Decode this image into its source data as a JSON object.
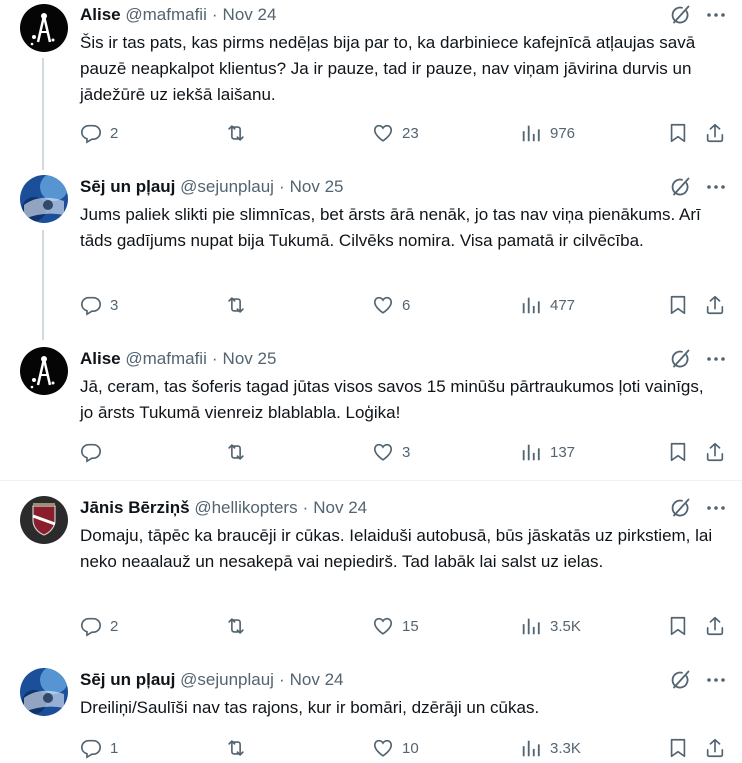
{
  "colors": {
    "text": "#0f1419",
    "secondary": "#536471",
    "divider": "#eff3f4",
    "thread": "#cfd9de"
  },
  "tweets": [
    {
      "name": "Alise",
      "handle": "@mafmafii",
      "date": "Nov 24",
      "text": "Šis ir tas pats, kas pirms nedēļas bija par to, ka darbiniece kafejnīcā atļaujas savā pauzē neapkalpot klientus? Ja ir pauze, tad ir pauze, nav viņam jāvirina durvis un jādežūrē uz iekšā laišanu.",
      "replies": "2",
      "retweets": "",
      "likes": "23",
      "views": "976",
      "avatar": "alise-avatar"
    },
    {
      "name": "Sēj un pļauj",
      "handle": "@sejunplauj",
      "date": "Nov 25",
      "text": "Jums paliek slikti pie slimnīcas, bet ārsts ārā nenāk, jo tas nav viņa pienākums. Arī tāds gadījums nupat bija Tukumā. Cilvēks nomira. Visa pamatā ir cilvēcība.",
      "replies": "3",
      "retweets": "",
      "likes": "6",
      "views": "477",
      "avatar": "earth-avatar"
    },
    {
      "name": "Alise",
      "handle": "@mafmafii",
      "date": "Nov 25",
      "text": "Jā, ceram, tas šoferis tagad jūtas visos savos 15 minūšu pārtraukumos ļoti vainīgs, jo ārsts Tukumā vienreiz blablabla. Loģika!",
      "replies": "",
      "retweets": "",
      "likes": "3",
      "views": "137",
      "avatar": "alise-avatar"
    },
    {
      "name": "Jānis Bērziņš",
      "handle": "@hellikopters",
      "date": "Nov 24",
      "text": "Domaju, tāpēc ka braucēji ir cūkas. Ielaiduši autobusā, būs jāskatās uz pirkstiem, lai neko neaalauž un nesakepā vai nepiedirš. Tad labāk lai salst uz ielas.",
      "replies": "2",
      "retweets": "",
      "likes": "15",
      "views": "3.5K",
      "avatar": "shield-avatar"
    },
    {
      "name": "Sēj un pļauj",
      "handle": "@sejunplauj",
      "date": "Nov 24",
      "text": "Dreiliņi/Saulīši nav tas rajons, kur ir bomāri, dzērāji un cūkas.",
      "replies": "1",
      "retweets": "",
      "likes": "10",
      "views": "3.3K",
      "avatar": "earth-avatar"
    }
  ]
}
